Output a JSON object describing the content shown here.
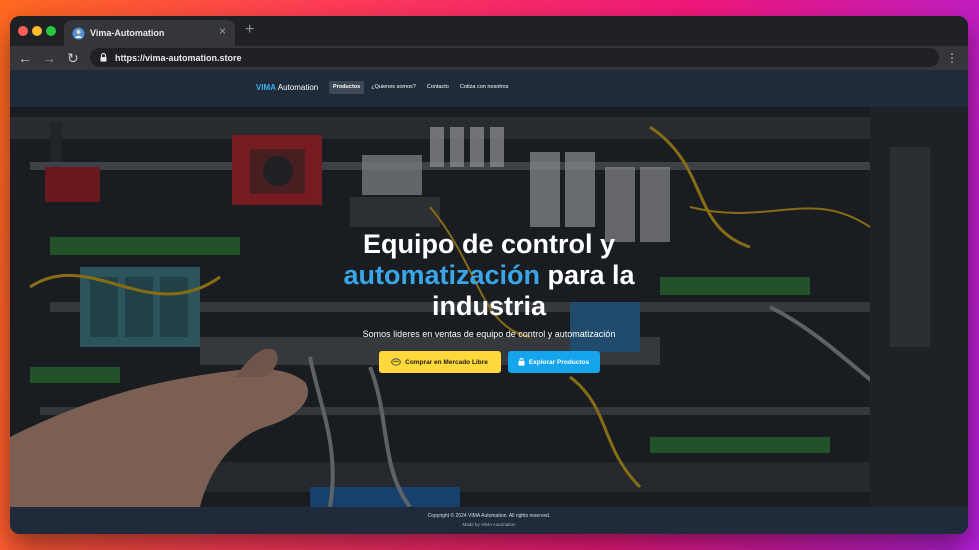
{
  "browser": {
    "tab_title": "Vima-Automation",
    "tab_close": "×",
    "new_tab": "+",
    "url": "https://vima-automation.store",
    "back_glyph": "←",
    "forward_glyph": "→",
    "reload_glyph": "↻",
    "menu_glyph": "⋮"
  },
  "site": {
    "brand_part1": "VIMA",
    "brand_part2": "Automation",
    "nav": [
      {
        "label": "Productos",
        "active": true
      },
      {
        "label": "¿Quienes somos?",
        "active": false
      },
      {
        "label": "Contacto",
        "active": false
      },
      {
        "label": "Cotiza con nosotros",
        "active": false
      }
    ]
  },
  "hero": {
    "headline_line1": "Equipo de control y",
    "headline_accent": "automatización",
    "headline_line2_rest": " para la",
    "headline_line3": "industria",
    "subtitle": "Somos lideres en ventas de equipo de control y automatización",
    "btn_mercadolibre": "Comprar en Mercado Libre",
    "btn_explore": "Explorar Productos",
    "icon_mercadolibre": "mercadolibre-handshake-icon",
    "icon_explore": "bag-icon",
    "background": "industrial-control-panel-wiring-photo"
  },
  "footer": {
    "copyright": "Copyright © 2024 VIMA Automation. All rights reserved.",
    "made_by": "Made by VIMA Automation"
  },
  "colors": {
    "accent": "#3aa6e8",
    "nav_bg": "#1f2a3a",
    "btn_yellow": "#ffd93b",
    "btn_blue": "#14a5ec"
  }
}
